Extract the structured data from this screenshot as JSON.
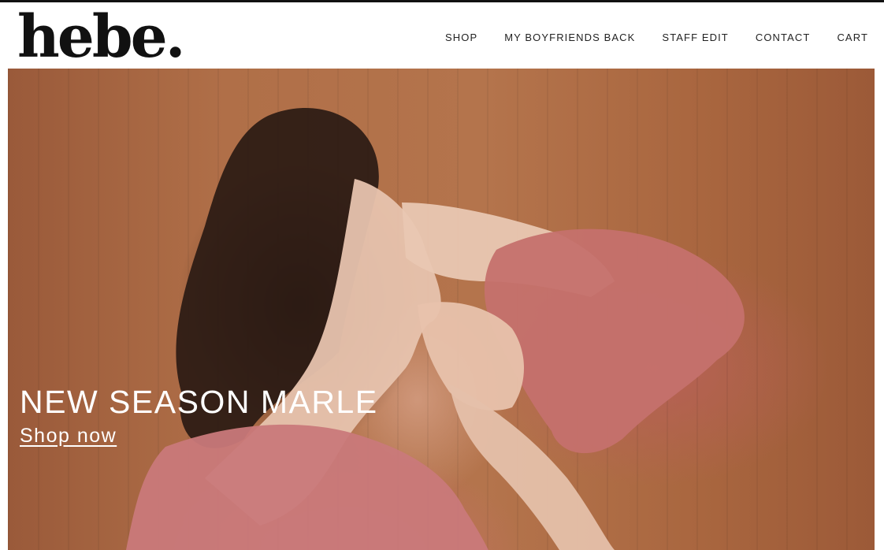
{
  "brand": {
    "logo_text": "hebe."
  },
  "nav": {
    "items": [
      {
        "label": "SHOP"
      },
      {
        "label": "MY BOYFRIENDS BACK"
      },
      {
        "label": "STAFF EDIT"
      },
      {
        "label": "CONTACT"
      },
      {
        "label": "CART"
      }
    ]
  },
  "hero": {
    "title": "NEW SEASON MARLE",
    "cta_label": "Shop now"
  },
  "colors": {
    "header_bg": "#ffffff",
    "text_dark": "#111111",
    "hero_text": "#ffffff",
    "wood_tone": "#b06f48",
    "dress_pink": "#c26e6c"
  }
}
